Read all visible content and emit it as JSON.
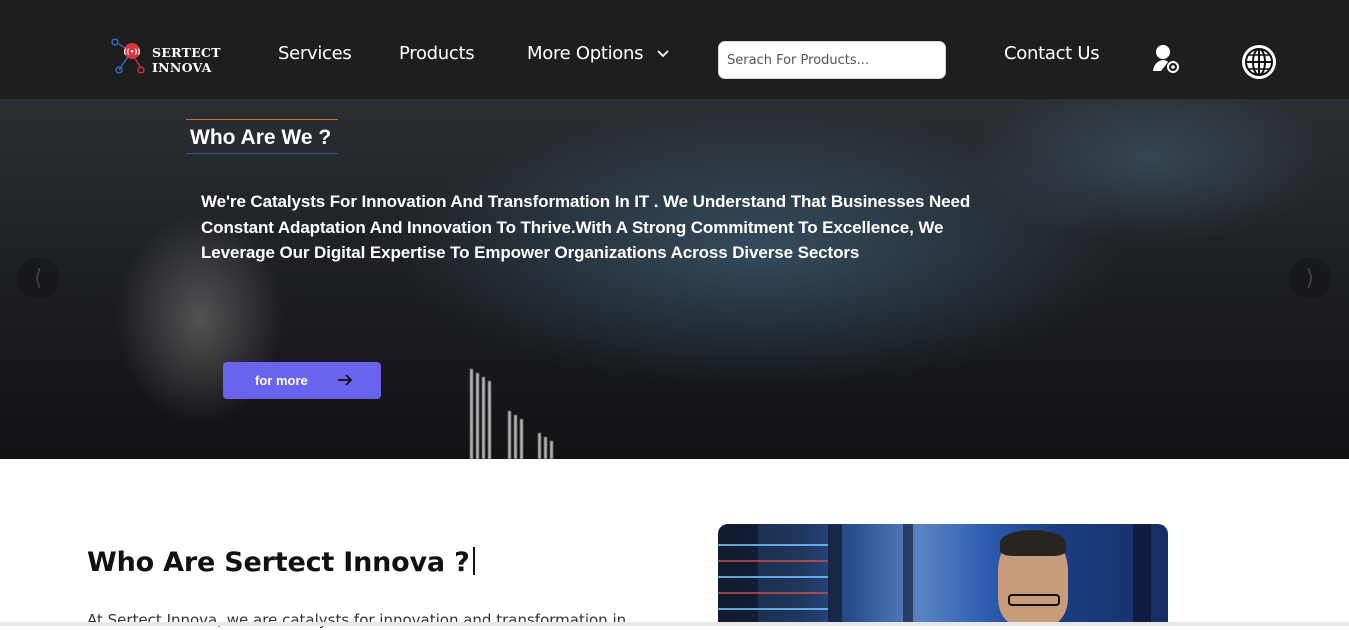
{
  "navbar": {
    "logo": {
      "line1": "SERTECT",
      "line2": "INNOVA"
    },
    "links": [
      {
        "label": "Services"
      },
      {
        "label": "Products"
      },
      {
        "label": "More Options"
      },
      {
        "label": "Contact Us"
      }
    ],
    "search": {
      "placeholder": "Serach For Products..."
    },
    "icons": {
      "user": "user-settings-icon",
      "language": "globe-icon",
      "dropdown": "chevron-down-icon"
    }
  },
  "hero": {
    "title": "Who Are We ?",
    "description": "We're Catalysts For Innovation And Transformation In IT . We Understand That Businesses Need Constant Adaptation And Innovation To Thrive.With A Strong Commitment To Excellence, We Leverage Our Digital Expertise To Empower Organizations Across Diverse Sectors",
    "button_label": "for more",
    "prev_glyph": "⟨",
    "next_glyph": "⟩"
  },
  "about": {
    "heading": "Who Are Sertect Innova ?",
    "text": "At Sertect Innova, we are catalysts for innovation and transformation in"
  },
  "colors": {
    "navbar_bg": "#1e1e1e",
    "button_bg": "#6a63ee",
    "title_top_border": "#c6732f",
    "title_bottom_border": "#3c4fa8"
  }
}
